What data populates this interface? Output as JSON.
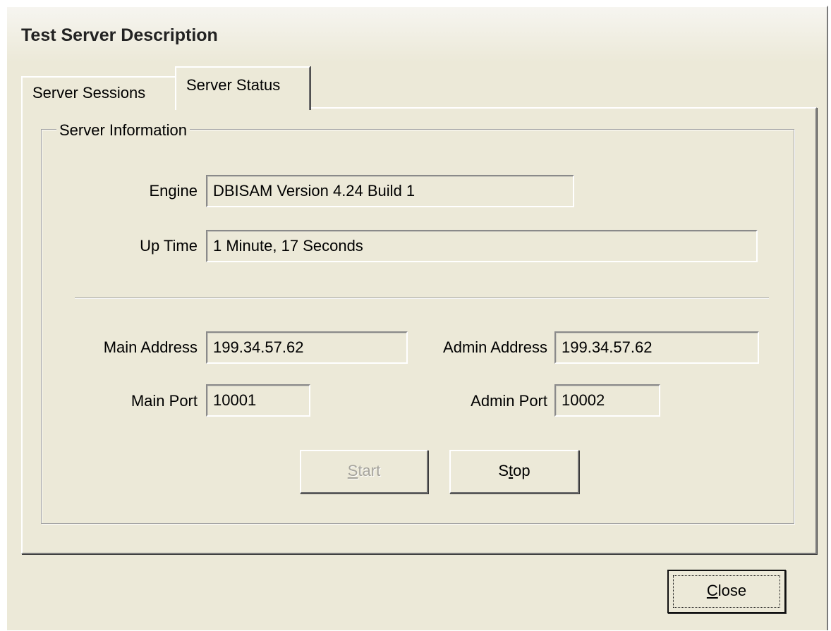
{
  "window": {
    "title": "Test Server Description"
  },
  "tabs": [
    {
      "label": "Server Sessions",
      "active": false
    },
    {
      "label": "Server Status",
      "active": true
    }
  ],
  "server_info": {
    "group_label": "Server Information",
    "engine_label": "Engine",
    "engine_value": "DBISAM Version 4.24 Build 1",
    "uptime_label": "Up Time",
    "uptime_value": "1 Minute, 17 Seconds",
    "main_address_label": "Main Address",
    "main_address_value": "199.34.57.62",
    "admin_address_label": "Admin Address",
    "admin_address_value": "199.34.57.62",
    "main_port_label": "Main Port",
    "main_port_value": "10001",
    "admin_port_label": "Admin Port",
    "admin_port_value": "10002"
  },
  "buttons": {
    "start": {
      "label": "Start",
      "accel": "S",
      "enabled": false
    },
    "stop": {
      "label": "Stop",
      "accel": "t",
      "enabled": true
    },
    "close": {
      "label": "Close",
      "accel": "C",
      "enabled": true
    }
  }
}
